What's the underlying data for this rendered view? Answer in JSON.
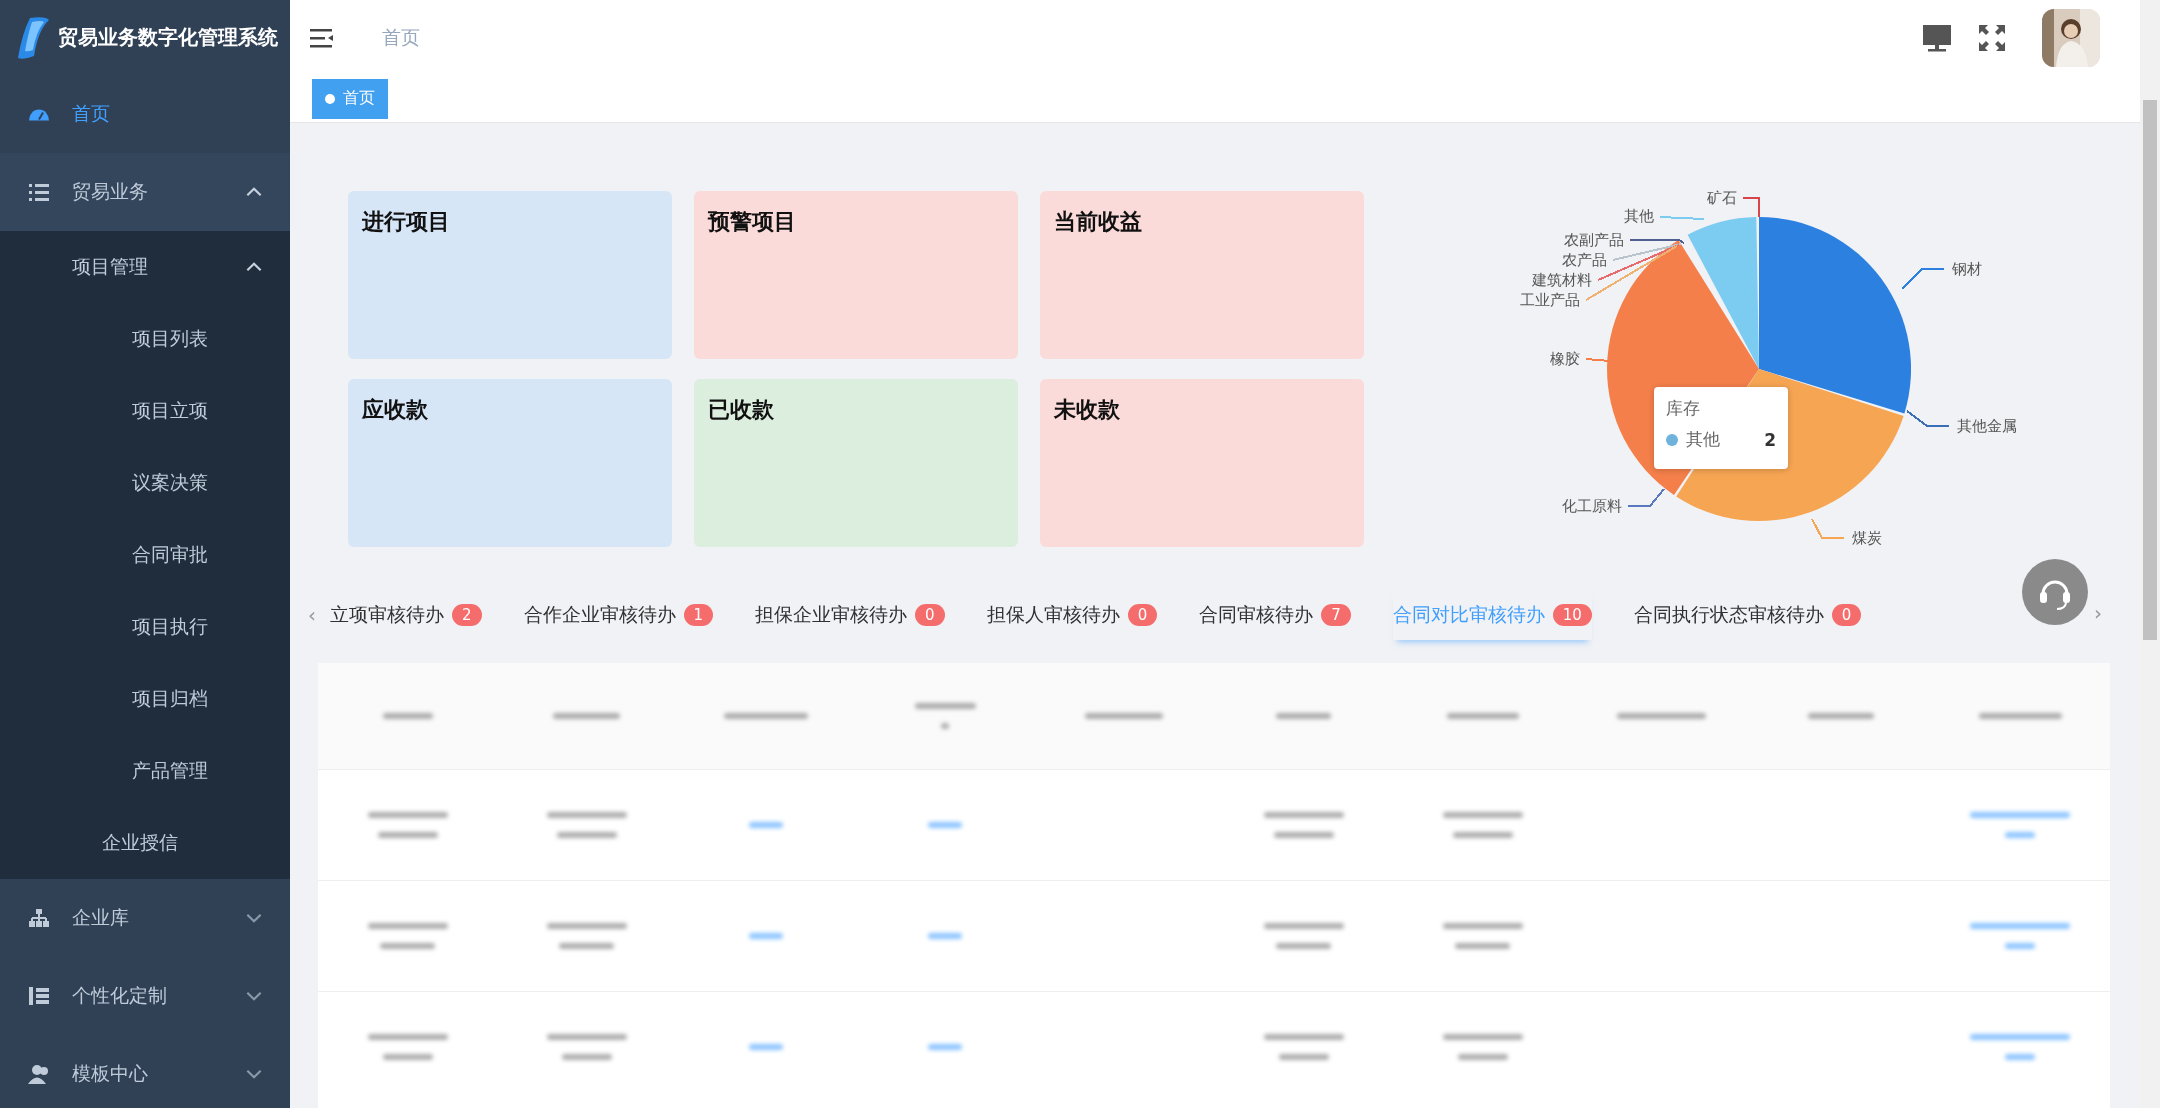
{
  "sidebar": {
    "title": "贸易业务数字化管理系统",
    "items": [
      {
        "label": "首页",
        "selected": true
      },
      {
        "label": "贸易业务",
        "selected": false,
        "expanded": true,
        "children": [
          {
            "label": "项目管理",
            "expanded": true,
            "children": [
              {
                "label": "项目列表"
              },
              {
                "label": "项目立项"
              },
              {
                "label": "议案决策"
              },
              {
                "label": "合同审批"
              },
              {
                "label": "项目执行"
              },
              {
                "label": "项目归档"
              },
              {
                "label": "产品管理"
              }
            ]
          },
          {
            "label": "企业授信"
          }
        ]
      },
      {
        "label": "企业库",
        "selected": false,
        "expanded": false
      },
      {
        "label": "个性化定制",
        "selected": false,
        "expanded": false
      },
      {
        "label": "模板中心",
        "selected": false,
        "expanded": false
      }
    ]
  },
  "header": {
    "breadcrumb": "首页"
  },
  "tags": [
    {
      "label": "首页",
      "selected": true
    }
  ],
  "cards": [
    {
      "title": "进行项目",
      "color": "#d7e6f7"
    },
    {
      "title": "预警项目",
      "color": "#fbdbd9"
    },
    {
      "title": "当前收益",
      "color": "#fbdbd9"
    },
    {
      "title": "应收款",
      "color": "#d7e6f7"
    },
    {
      "title": "已收款",
      "color": "#dcefdf"
    },
    {
      "title": "未收款",
      "color": "#fbdbd9"
    }
  ],
  "chart": {
    "slices": [
      {
        "label": "矿石",
        "color": "#d9434a"
      },
      {
        "label": "其他",
        "color": "#7ccbf0"
      },
      {
        "label": "农副产品",
        "color": "#4f5f90"
      },
      {
        "label": "农产品",
        "color": "#b8c4cc"
      },
      {
        "label": "钢材",
        "color": "#2b80e0"
      },
      {
        "label": "建筑材料",
        "color": "#e86a6a"
      },
      {
        "label": "工业产品",
        "color": "#f0b070"
      },
      {
        "label": "橡胶",
        "color": "#f47f4a"
      },
      {
        "label": "其他金属",
        "color": "#3a6fb8"
      },
      {
        "label": "化工原料",
        "color": "#5a78c0"
      },
      {
        "label": "煤炭",
        "color": "#f6a553"
      }
    ],
    "tooltip": {
      "title": "库存",
      "label": "其他",
      "value": "2",
      "color": "#6fb2dc"
    }
  },
  "tab_nav": {
    "prev": "‹",
    "next": "›"
  },
  "tabs": [
    {
      "label": "立项审核待办",
      "count": "2",
      "selected": false
    },
    {
      "label": "合作企业审核待办",
      "count": "1",
      "selected": false
    },
    {
      "label": "担保企业审核待办",
      "count": "0",
      "selected": false
    },
    {
      "label": "担保人审核待办",
      "count": "0",
      "selected": false
    },
    {
      "label": "合同审核待办",
      "count": "7",
      "selected": false
    },
    {
      "label": "合同对比审核待办",
      "count": "10",
      "selected": true
    },
    {
      "label": "合同执行状态审核待办",
      "count": "0",
      "selected": false
    }
  ]
}
